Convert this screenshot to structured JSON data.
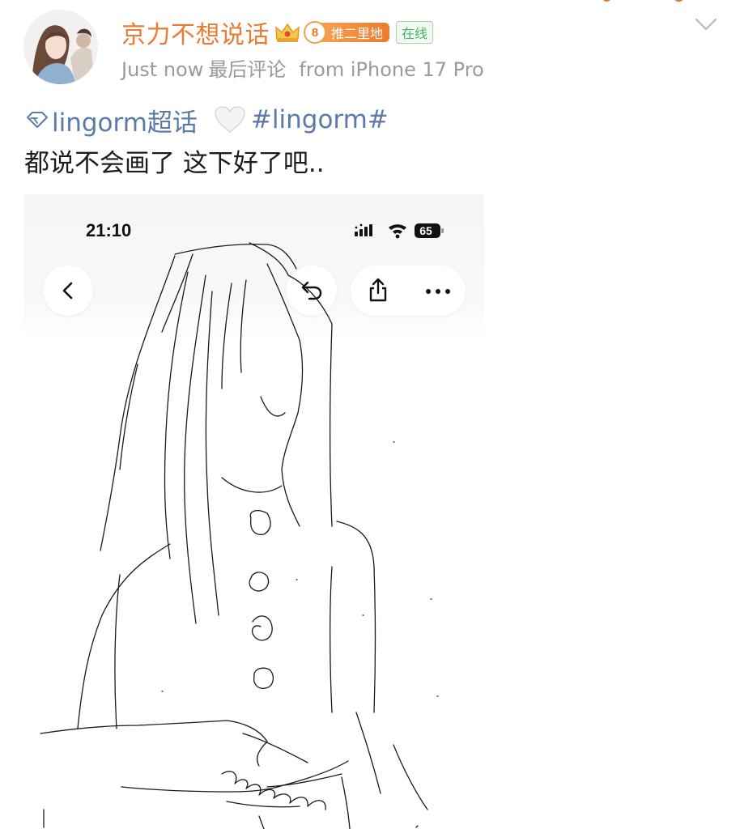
{
  "user": {
    "name": "京力不想说话",
    "fan_level": "8",
    "fan_group": "推二里地",
    "online": "在线",
    "name_color": "#eb7a32"
  },
  "meta": {
    "time": "Just now",
    "comment_label": "最后评论",
    "source": "from iPhone 17 Pro"
  },
  "post": {
    "super_topic": "lingorm超话",
    "hashtag": "#lingorm#",
    "text": "都说不会画了 这下好了吧..",
    "link_color": "#5b7aa8"
  },
  "image": {
    "status_time": "21:10",
    "battery": "65"
  },
  "icons": {
    "avatar": "avatar-illustration",
    "crown": "crown-icon",
    "diamond": "diamond-icon",
    "heart": "white-heart-icon",
    "chevron": "chevron-down-icon"
  }
}
